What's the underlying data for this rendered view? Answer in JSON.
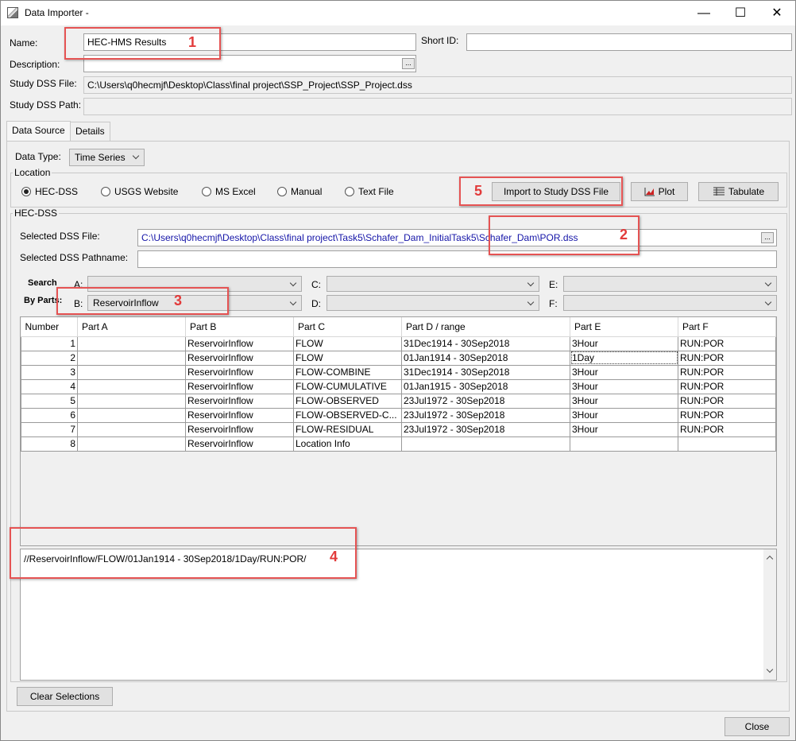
{
  "window": {
    "title": "Data Importer -",
    "controls": {
      "minimize": "—",
      "maximize": "☐",
      "close": "✕"
    }
  },
  "form": {
    "name_label": "Name:",
    "name_value": "HEC-HMS Results",
    "short_id_label": "Short ID:",
    "short_id_value": "",
    "description_label": "Description:",
    "description_value": "",
    "browse": "...",
    "study_dss_file_label": "Study DSS File:",
    "study_dss_file_value": "C:\\Users\\q0hecmjf\\Desktop\\Class\\final project\\SSP_Project\\SSP_Project.dss",
    "study_dss_path_label": "Study DSS Path:",
    "study_dss_path_value": ""
  },
  "tabs": [
    {
      "label": "Data Source",
      "active": true
    },
    {
      "label": "Details",
      "active": false
    }
  ],
  "data_type": {
    "label": "Data Type:",
    "value": "Time Series"
  },
  "location": {
    "title": "Location",
    "options": [
      {
        "label": "HEC-DSS",
        "selected": true
      },
      {
        "label": "USGS Website",
        "selected": false
      },
      {
        "label": "MS Excel",
        "selected": false
      },
      {
        "label": "Manual",
        "selected": false
      },
      {
        "label": "Text File",
        "selected": false
      }
    ],
    "import_button": "Import to Study DSS File",
    "plot_button": "Plot",
    "tabulate_button": "Tabulate"
  },
  "hecdss": {
    "title": "HEC-DSS",
    "selected_file_label": "Selected DSS File:",
    "selected_file_value": "C:\\Users\\q0hecmjf\\Desktop\\Class\\final project\\Task5\\Schafer_Dam_InitialTask5\\Schafer_Dam\\POR.dss",
    "selected_path_label": "Selected DSS Pathname:",
    "selected_path_value": "",
    "search_label": "Search",
    "by_parts_label": "By Parts:",
    "parts": {
      "a_label": "A:",
      "a_value": "",
      "b_label": "B:",
      "b_value": "ReservoirInflow",
      "c_label": "C:",
      "c_value": "",
      "d_label": "D:",
      "d_value": "",
      "e_label": "E:",
      "e_value": "",
      "f_label": "F:",
      "f_value": ""
    }
  },
  "table": {
    "headers": [
      "Number",
      "Part A",
      "Part B",
      "Part C",
      "Part D / range",
      "Part E",
      "Part F"
    ],
    "rows": [
      [
        "1",
        "",
        "ReservoirInflow",
        "FLOW",
        "31Dec1914 - 30Sep2018",
        "3Hour",
        "RUN:POR"
      ],
      [
        "2",
        "",
        "ReservoirInflow",
        "FLOW",
        "01Jan1914 - 30Sep2018",
        "1Day",
        "RUN:POR"
      ],
      [
        "3",
        "",
        "ReservoirInflow",
        "FLOW-COMBINE",
        "31Dec1914 - 30Sep2018",
        "3Hour",
        "RUN:POR"
      ],
      [
        "4",
        "",
        "ReservoirInflow",
        "FLOW-CUMULATIVE",
        "01Jan1915 - 30Sep2018",
        "3Hour",
        "RUN:POR"
      ],
      [
        "5",
        "",
        "ReservoirInflow",
        "FLOW-OBSERVED",
        "23Jul1972 - 30Sep2018",
        "3Hour",
        "RUN:POR"
      ],
      [
        "6",
        "",
        "ReservoirInflow",
        "FLOW-OBSERVED-C...",
        "23Jul1972 - 30Sep2018",
        "3Hour",
        "RUN:POR"
      ],
      [
        "7",
        "",
        "ReservoirInflow",
        "FLOW-RESIDUAL",
        "23Jul1972 - 30Sep2018",
        "3Hour",
        "RUN:POR"
      ],
      [
        "8",
        "",
        "ReservoirInflow",
        "Location Info",
        "",
        "",
        ""
      ]
    ]
  },
  "selected_path_text": "//ReservoirInflow/FLOW/01Jan1914 - 30Sep2018/1Day/RUN:POR/",
  "clear_button": "Clear Selections",
  "close_button": "Close",
  "annotations": [
    "1",
    "2",
    "3",
    "4",
    "5"
  ],
  "colors": {
    "annotation": "#e55353",
    "path_text": "#1515a8"
  }
}
